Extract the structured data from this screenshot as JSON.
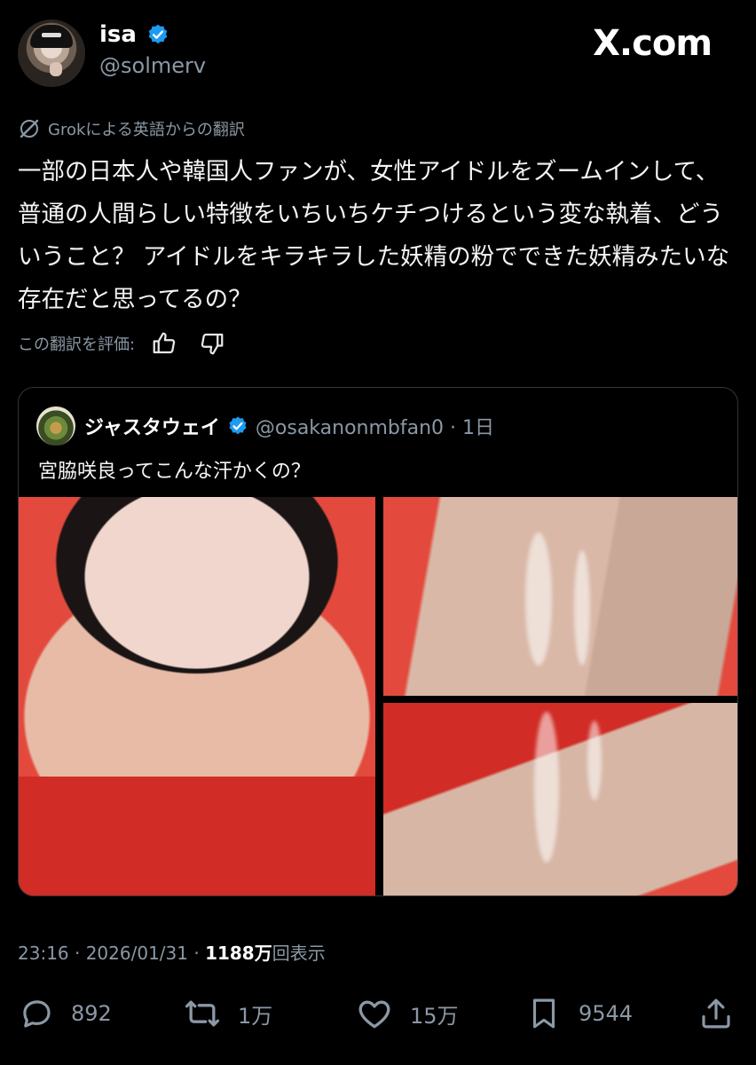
{
  "author": {
    "display_name": "isa",
    "handle": "@solmerv"
  },
  "brand": "X.com",
  "translation": {
    "label": "Grokによる英語からの翻訳",
    "rate_label": "この翻訳を評価:"
  },
  "tweet": {
    "text": "一部の日本人や韓国人ファンが、女性アイドルをズームインして、普通の人間らしい特徴をいちいちケチつけるという変な執着、どういうこと？ アイドルをキラキラした妖精の粉でできた妖精みたいな存在だと思ってるの？"
  },
  "quote": {
    "display_name": "ジャスタウェイ",
    "handle_time": "@osakanonmbfan0 · 1日",
    "text": "宮脇咲良ってこんな汗かくの？"
  },
  "meta": {
    "time_date": "23:16 · 2026/01/31 · ",
    "views_count": "1188万",
    "views_label": "回表示"
  },
  "actions": {
    "replies": "892",
    "reposts": "1万",
    "likes": "15万",
    "bookmarks": "9544"
  },
  "icons": [
    "verified-badge-icon",
    "grok-icon",
    "thumbs-up-icon",
    "thumbs-down-icon",
    "reply-icon",
    "repost-icon",
    "like-icon",
    "bookmark-icon",
    "share-icon"
  ],
  "colors": {
    "background": "#000000",
    "verified": "#1d9bf0",
    "secondary_text": "#8b98a5"
  }
}
